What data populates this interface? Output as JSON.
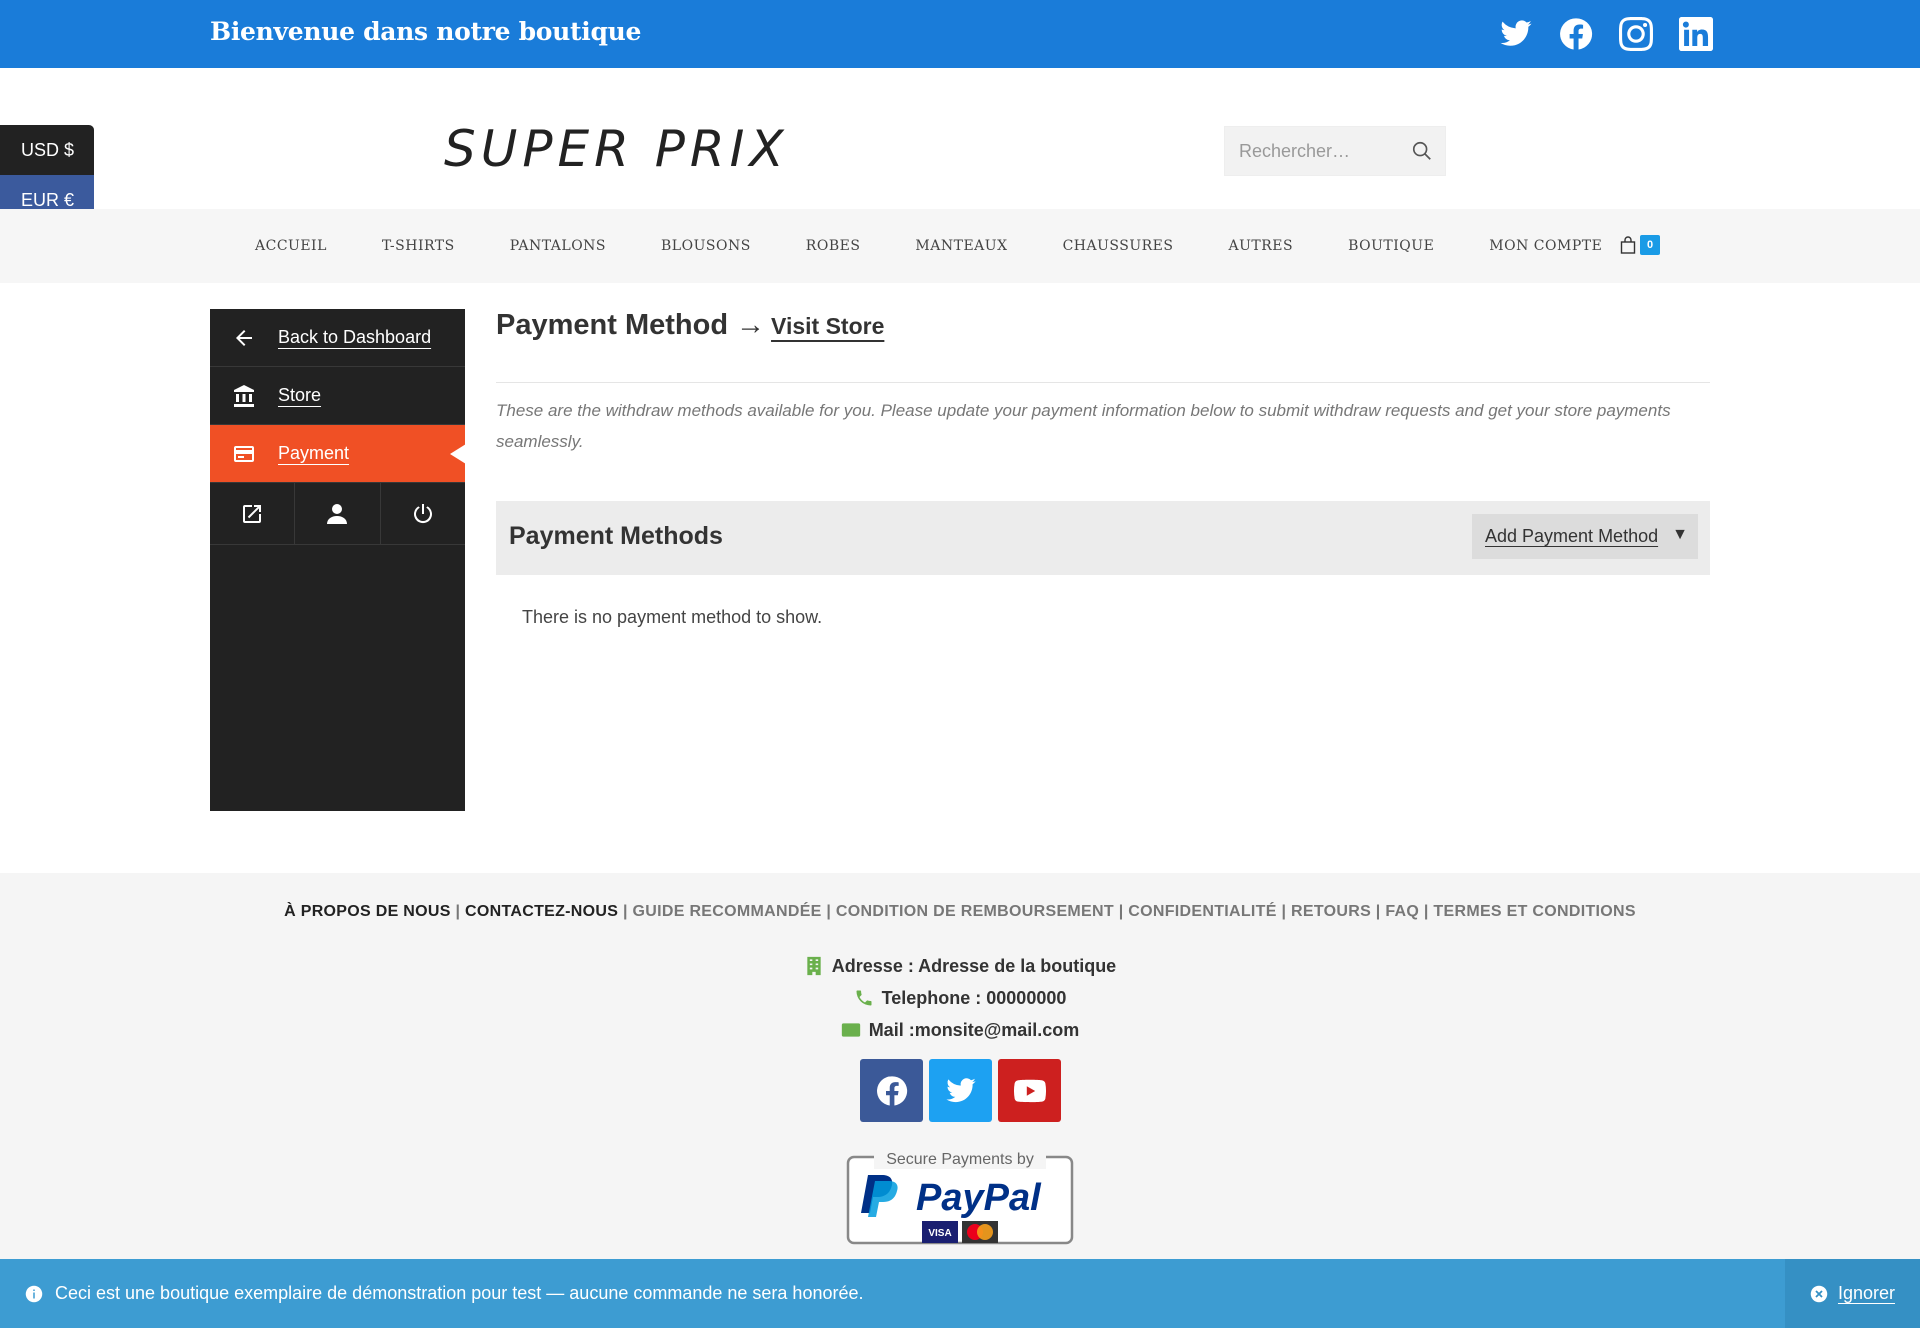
{
  "topbar": {
    "welcome": "Bienvenue dans notre boutique",
    "socials": [
      "twitter-icon",
      "facebook-icon",
      "instagram-icon",
      "linkedin-icon"
    ],
    "bg_color": "#1a7cd9"
  },
  "currency": {
    "usd": "USD $",
    "eur": "EUR €"
  },
  "header": {
    "logo": "SUPER PRIX",
    "search_placeholder": "Rechercher…"
  },
  "nav": {
    "items": [
      "ACCUEIL",
      "T-SHIRTS",
      "PANTALONS",
      "BLOUSONS",
      "ROBES",
      "MANTEAUX",
      "CHAUSSURES",
      "AUTRES",
      "BOUTIQUE",
      "MON COMPTE"
    ],
    "cart_count": "0"
  },
  "sidebar": {
    "back": "Back to Dashboard",
    "store": "Store",
    "payment": "Payment",
    "active_color": "#f05025"
  },
  "main": {
    "title": "Payment Method",
    "arrow": "→",
    "visit_store": "Visit Store",
    "description": "These are the withdraw methods available for you. Please update your payment information below to submit withdraw requests and get your store payments seamlessly.",
    "section_title": "Payment Methods",
    "add_button": "Add Payment Method",
    "caret": "▼",
    "empty": "There is no payment method to show."
  },
  "footer": {
    "links": [
      "À PROPOS DE NOUS",
      "CONTACTEZ-NOUS",
      "GUIDE RECOMMANDÉE",
      "CONDITION DE REMBOURSEMENT",
      "CONFIDENTIALITÉ",
      "RETOURS",
      "FAQ",
      "TERMES ET CONDITIONS"
    ],
    "address": "Adresse : Adresse de la boutique",
    "phone": "Telephone : 00000000",
    "mail": "Mail :monsite@mail.com",
    "paypal_caption": "Secure Payments by",
    "paypal_brand": "PayPal",
    "card_visa": "VISA",
    "social_colors": {
      "facebook": "#3b5998",
      "twitter": "#1da1f2",
      "youtube": "#cd201f"
    }
  },
  "notice": {
    "message": "Ceci est une boutique exemplaire de démonstration pour test — aucune commande ne sera honorée.",
    "dismiss": "Ignorer"
  }
}
